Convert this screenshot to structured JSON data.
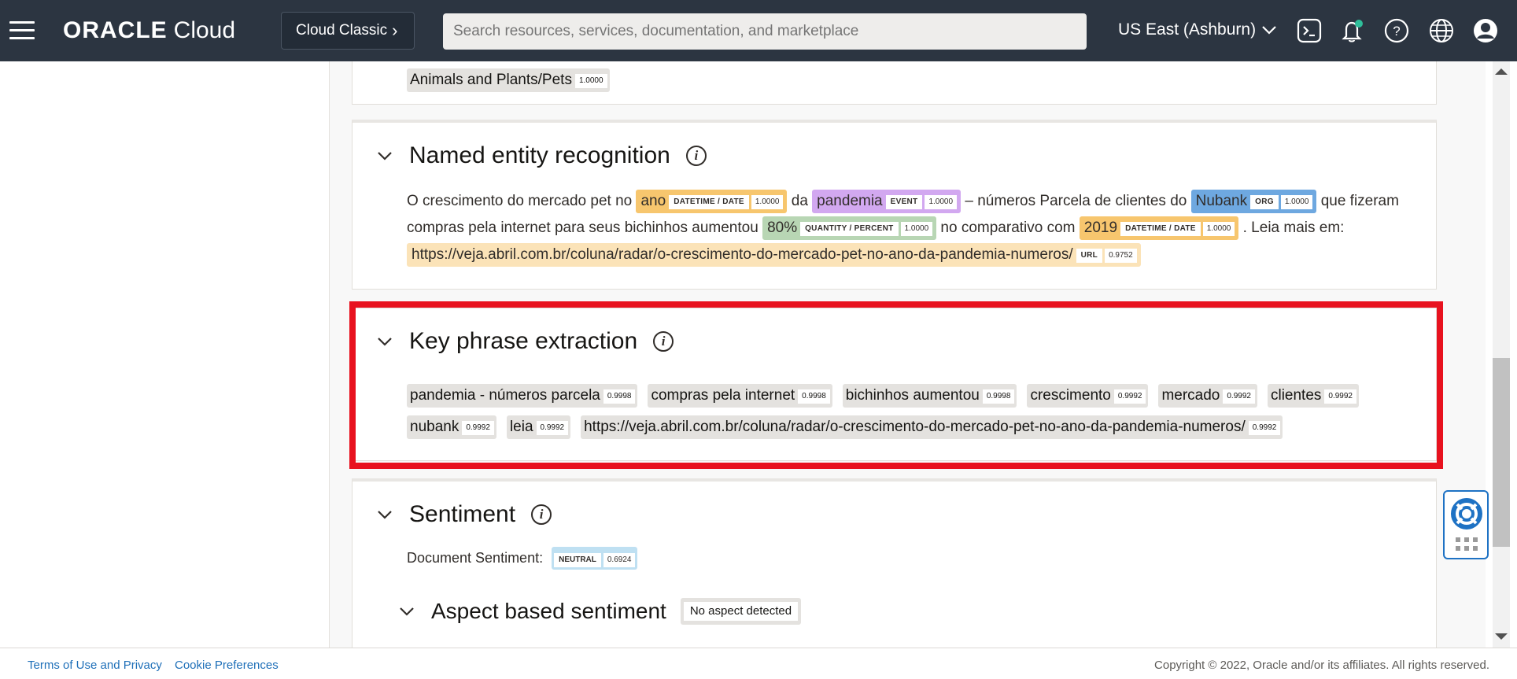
{
  "header": {
    "brand": "ORACLE",
    "product": "Cloud",
    "classic_label": "Cloud Classic",
    "search_placeholder": "Search resources, services, documentation, and marketplace",
    "region": "US East (Ashburn)",
    "icons": [
      "menu-icon",
      "cloud-shell-icon",
      "notifications-bell-icon",
      "help-icon",
      "language-globe-icon",
      "profile-avatar-icon"
    ]
  },
  "classification": {
    "label": "Animals and Plants/Pets",
    "score": "1.0000"
  },
  "ner": {
    "title": "Named entity recognition",
    "t1": "O crescimento do mercado pet no",
    "e1": {
      "text": "ano",
      "label": "DATETIME / DATE",
      "score": "1.0000"
    },
    "t2": "da",
    "e2": {
      "text": "pandemia",
      "label": "EVENT",
      "score": "1.0000"
    },
    "t3": "– números Parcela de clientes do",
    "e3": {
      "text": "Nubank",
      "label": "ORG",
      "score": "1.0000"
    },
    "t4": "que fizeram compras pela internet para seus bichinhos aumentou",
    "e4": {
      "text": "80%",
      "label": "QUANTITY / PERCENT",
      "score": "1.0000"
    },
    "t5": "no comparativo com",
    "e5": {
      "text": "2019",
      "label": "DATETIME / DATE",
      "score": "1.0000"
    },
    "t6": ". Leia mais em:",
    "e6": {
      "text": "https://veja.abril.com.br/coluna/radar/o-crescimento-do-mercado-pet-no-ano-da-pandemia-numeros/",
      "label": "URL",
      "score": "0.9752"
    }
  },
  "keyphrase": {
    "title": "Key phrase extraction",
    "phrases": [
      {
        "text": "pandemia - números parcela",
        "score": "0.9998"
      },
      {
        "text": "compras pela internet",
        "score": "0.9998"
      },
      {
        "text": "bichinhos aumentou",
        "score": "0.9998"
      },
      {
        "text": "crescimento",
        "score": "0.9992"
      },
      {
        "text": "mercado",
        "score": "0.9992"
      },
      {
        "text": "clientes",
        "score": "0.9992"
      },
      {
        "text": "nubank",
        "score": "0.9992"
      },
      {
        "text": "leia",
        "score": "0.9992"
      },
      {
        "text": "https://veja.abril.com.br/coluna/radar/o-crescimento-do-mercado-pet-no-ano-da-pandemia-numeros/",
        "score": "0.9992"
      }
    ]
  },
  "sentiment": {
    "title": "Sentiment",
    "doc_label": "Document Sentiment:",
    "value": "NEUTRAL",
    "score": "0.6924",
    "aspect_title": "Aspect based sentiment",
    "aspect_none": "No aspect detected"
  },
  "footer": {
    "terms": "Terms of Use and Privacy",
    "cookies": "Cookie Preferences",
    "copyright": "Copyright © 2022, Oracle and/or its affiliates. All rights reserved."
  },
  "colors": {
    "header_bg": "#2c3541",
    "highlight_border": "#e8121f",
    "date_entity": "#f7c66e",
    "event_entity": "#d2a8f0",
    "org_entity": "#6ea8e0",
    "quantity_entity": "#b8d6b4",
    "url_entity": "#fbe3b8",
    "link": "#1e6fb8"
  }
}
